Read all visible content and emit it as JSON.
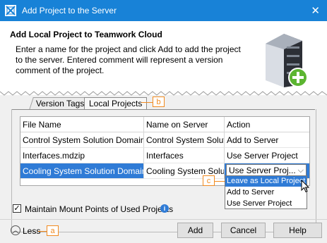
{
  "window": {
    "title": "Add Project to the Server",
    "close_glyph": "✕"
  },
  "header": {
    "title": "Add Local Project to Teamwork Cloud",
    "description": "Enter a name for the project and click Add to add the project to the server. Entered comment will represent a version comment of the project."
  },
  "tabs": [
    {
      "label": "Version Tags",
      "active": false
    },
    {
      "label": "Local Projects",
      "active": true
    }
  ],
  "table": {
    "columns": [
      "File Name",
      "Name on Server",
      "Action"
    ],
    "rows": [
      {
        "file": "Control System Solution Domain.mdzip",
        "file_display": "Control System Solution Domain....",
        "server_name": "Control System Solution",
        "action": "Add to Server"
      },
      {
        "file": "Interfaces.mdzip",
        "file_display": "Interfaces.mdzip",
        "server_name": "Interfaces",
        "action": "Use Server Project"
      },
      {
        "file": "Cooling System Solution Domain.mdzip",
        "file_display": "Cooling System Solution Domain....",
        "server_name": "Cooling System Solution",
        "action": "Use Server Proj...",
        "selected": true
      }
    ]
  },
  "action_dropdown": {
    "options": [
      "Leave as Local Project",
      "Add to Server",
      "Use Server Project"
    ],
    "highlighted": "Leave as Local Project"
  },
  "callouts": {
    "a": "a",
    "b": "b",
    "c": "c"
  },
  "options": {
    "maintain_mount_points_label": "Maintain Mount Points of Used Projects",
    "maintain_mount_points_checked": true,
    "check_glyph": "✓",
    "info_glyph": "i"
  },
  "footer": {
    "less_label": "Less",
    "less_glyph": "︿",
    "add_label": "Add",
    "cancel_label": "Cancel",
    "help_label": "Help"
  },
  "colors": {
    "titlebar": "#1882d7",
    "selection": "#2f7bd6",
    "callout": "#f18a1f"
  }
}
